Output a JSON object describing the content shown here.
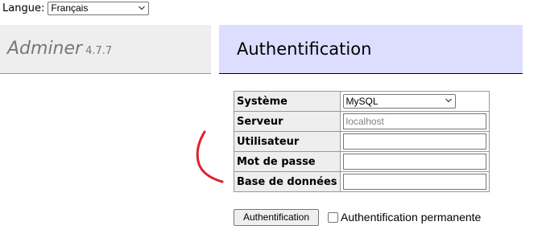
{
  "language": {
    "label": "Langue:",
    "selected": "Français"
  },
  "brand": {
    "name": "Adminer",
    "version": "4.7.7"
  },
  "heading": "Authentification",
  "form": {
    "rows": [
      {
        "label": "Système",
        "type": "select",
        "value": "MySQL"
      },
      {
        "label": "Serveur",
        "type": "input",
        "value": "",
        "placeholder": "localhost"
      },
      {
        "label": "Utilisateur",
        "type": "input",
        "value": ""
      },
      {
        "label": "Mot de passe",
        "type": "input",
        "value": ""
      },
      {
        "label": "Base de données",
        "type": "input",
        "value": ""
      }
    ],
    "submit_label": "Authentification",
    "permanent_label": "Authentification permanente",
    "permanent_checked": false
  },
  "colors": {
    "header_bg": "#ddddff",
    "sidebar_bg": "#eeeeee",
    "annotation": "#e0202a"
  }
}
